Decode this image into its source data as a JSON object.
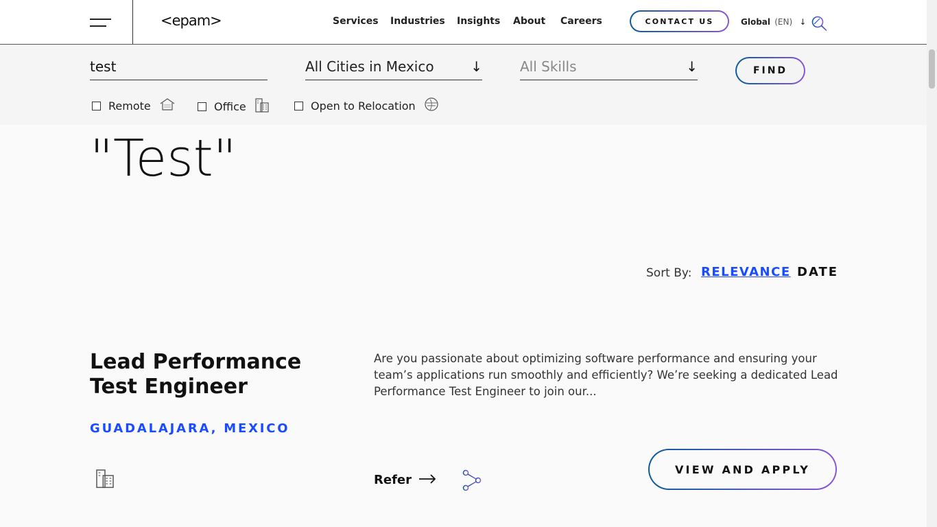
{
  "header": {
    "logo": "<epam>",
    "nav": [
      {
        "label": "Services"
      },
      {
        "label": "Industries"
      },
      {
        "label": "Insights"
      },
      {
        "label": "About"
      },
      {
        "label": "Careers"
      }
    ],
    "contact_label": "CONTACT US",
    "region_label": "Global",
    "language_label": "(EN)",
    "icons": {
      "menu": "hamburger-icon",
      "search": "search-icon",
      "region_arrow": "arrow-down-icon"
    }
  },
  "filters": {
    "keyword_value": "test",
    "location_value": "All Cities in Mexico",
    "skills_placeholder": "All Skills",
    "find_label": "FIND",
    "options": [
      {
        "label": "Remote",
        "checked": false,
        "icon": "home-icon"
      },
      {
        "label": "Office",
        "checked": false,
        "icon": "office-building-icon"
      },
      {
        "label": "Open to Relocation",
        "checked": false,
        "icon": "relocation-icon"
      }
    ]
  },
  "hero": {
    "title_visible": "\"Test\""
  },
  "sort": {
    "label": "Sort By:",
    "relevance_label": "RELEVANCE",
    "date_label": "DATE",
    "active": "RELEVANCE"
  },
  "job": {
    "title": "Lead Performance Test Engineer",
    "location": "GUADALAJARA, MEXICO",
    "description": "Are you passionate about optimizing software performance and ensuring your team’s applications run smoothly and efficiently? We’re seeking a dedicated Lead Performance Test Engineer to join our...",
    "refer_label": "Refer",
    "apply_label": "VIEW AND APPLY",
    "work_type_icon": "office-building-icon"
  },
  "colors": {
    "accent_blue": "#1a4cff",
    "gradient_start": "#0b5c9e",
    "gradient_end": "#8a56d6"
  }
}
